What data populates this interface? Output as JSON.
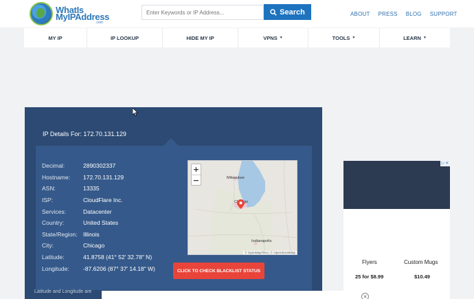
{
  "header": {
    "logo_line1": "WhatIs",
    "logo_line2": "MyIPAddress",
    "logo_line3": ".com",
    "search": {
      "placeholder": "Enter Keywords or IP Address...",
      "button_label": "Search"
    },
    "top_links": [
      "ABOUT",
      "PRESS",
      "BLOG",
      "SUPPORT"
    ]
  },
  "nav": {
    "items": [
      {
        "label": "MY IP",
        "dropdown": false
      },
      {
        "label": "IP LOOKUP",
        "dropdown": false
      },
      {
        "label": "HIDE MY IP",
        "dropdown": false
      },
      {
        "label": "VPNS",
        "dropdown": true
      },
      {
        "label": "TOOLS",
        "dropdown": true
      },
      {
        "label": "LEARN",
        "dropdown": true
      }
    ]
  },
  "ip_details": {
    "title": "IP Details For: 172.70.131.129",
    "rows": [
      {
        "key": "Decimal:",
        "value": "2890302337"
      },
      {
        "key": "Hostname:",
        "value": "172.70.131.129"
      },
      {
        "key": "ASN:",
        "value": "13335"
      },
      {
        "key": "ISP:",
        "value": "CloudFlare Inc."
      },
      {
        "key": "Services:",
        "value": "Datacenter"
      },
      {
        "key": "Country:",
        "value": "United States"
      },
      {
        "key": "State/Region:",
        "value": "Illinois"
      },
      {
        "key": "City:",
        "value": "Chicago"
      },
      {
        "key": "Latitude:",
        "value": "41.8758  (41° 52′ 32.78″ N)"
      },
      {
        "key": "Longitude:",
        "value": "-87.6206  (87° 37′ 14.18″ W)"
      }
    ],
    "blacklist_button": "CLICK TO CHECK BLACKLIST STATUS",
    "note": "Latitude and Longitude are"
  },
  "map": {
    "zoom_in": "+",
    "zoom_out": "−",
    "labels": {
      "milwaukee": "Milwaukee",
      "chicago": "Chicago",
      "indianapolis": "Indianapolis"
    },
    "attribution": "© OpenMapTiles | © OpenStreetMap"
  },
  "ad": {
    "items": [
      {
        "name": "Flyers",
        "price": "25 for $8.99"
      },
      {
        "name": "Custom Mugs",
        "price": "$10.49"
      }
    ]
  },
  "colors": {
    "brand": "#1e73be",
    "panel": "#2c4a73",
    "inner_panel": "#35598a",
    "accent_button": "#e8443a"
  }
}
